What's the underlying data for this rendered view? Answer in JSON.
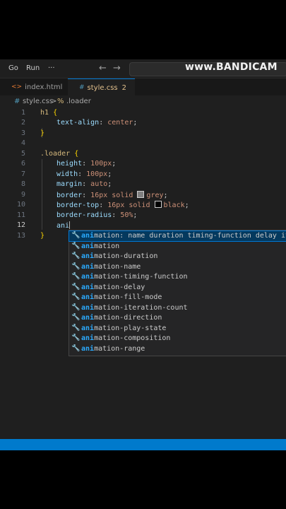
{
  "menu": {
    "go": "Go",
    "run": "Run",
    "more": "···",
    "back": "←",
    "forward": "→"
  },
  "watermark": "www.BANDICAM",
  "tabs": [
    {
      "icon": "<>",
      "label": "index.html"
    },
    {
      "icon": "#",
      "label": "style.css",
      "badge": "2"
    }
  ],
  "breadcrumb": {
    "file_icon": "#",
    "file": "style.css",
    "sep": ">",
    "symbol_icon": "%",
    "symbol": ".loader"
  },
  "gutter": [
    "1",
    "2",
    "3",
    "4",
    "5",
    "6",
    "7",
    "8",
    "9",
    "10",
    "11",
    "12",
    "13"
  ],
  "code": {
    "l1": {
      "sel": "h1",
      "brace": "{"
    },
    "l2": {
      "prop": "text-align",
      "val": "center"
    },
    "l3": {
      "brace": "}"
    },
    "l5": {
      "sel": ".loader",
      "brace": "{"
    },
    "l6": {
      "prop": "height",
      "val": "100px"
    },
    "l7": {
      "prop": "width",
      "val": "100px"
    },
    "l8": {
      "prop": "margin",
      "val": "auto"
    },
    "l9": {
      "prop": "border",
      "val1": "16px solid",
      "val2": "grey"
    },
    "l10": {
      "prop": "border-top",
      "val1": "16px solid",
      "val2": "black"
    },
    "l11": {
      "prop": "border-radius",
      "val": "50%"
    },
    "l12": {
      "typed": "ani"
    },
    "l13": {
      "brace": "}"
    }
  },
  "suggestions": {
    "match": "ani",
    "items": [
      "mation: name duration timing-function delay it…",
      "mation",
      "mation-duration",
      "mation-name",
      "mation-timing-function",
      "mation-delay",
      "mation-fill-mode",
      "mation-iteration-count",
      "mation-direction",
      "mation-play-state",
      "mation-composition",
      "mation-range"
    ]
  },
  "colors": {
    "accent": "#0078d4",
    "status": "#007acc",
    "grey_swatch": "#808080",
    "black_swatch": "#000000"
  }
}
